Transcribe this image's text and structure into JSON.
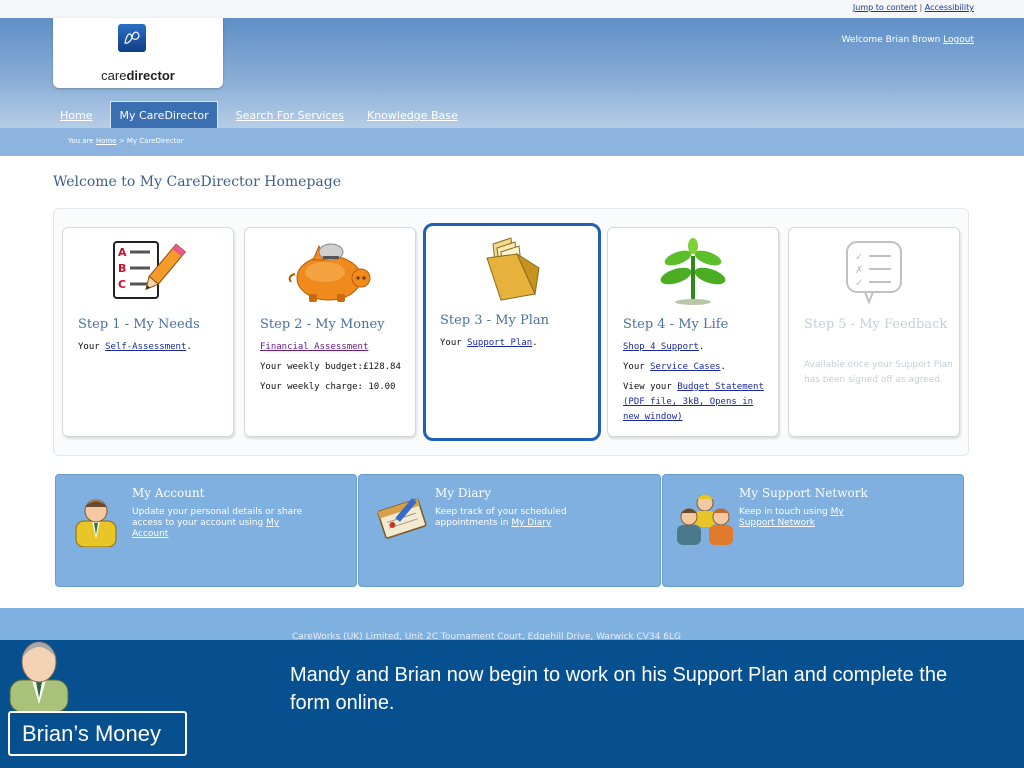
{
  "util": {
    "jump_link": "Jump to content",
    "separator": "|",
    "accessibility_link": "Accessibility"
  },
  "header": {
    "logo_text_light": "care",
    "logo_text_bold": "director",
    "welcome_text": "Welcome  Brian Brown",
    "logout_link": "Logout",
    "nav": [
      {
        "label": "Home",
        "active": false
      },
      {
        "label": "My CareDirector",
        "active": true
      },
      {
        "label": "Search For Services",
        "active": false
      },
      {
        "label": "Knowledge Base",
        "active": false
      }
    ]
  },
  "breadcrumb": {
    "prefix": "You are",
    "home": "Home",
    "current": "> My CareDirector"
  },
  "page_title": "Welcome to My CareDirector Homepage",
  "steps": [
    {
      "title": "Step 1 - My Needs",
      "icon": "checklist-pencil-icon",
      "line1_prefix": "Your ",
      "line1_link": "Self-Assessment",
      "line1_suffix": "."
    },
    {
      "title": "Step 2 - My Money",
      "icon": "piggy-bank-icon",
      "link": "Financial Assessment",
      "budget": "Your weekly budget:£128.84",
      "charge": "Your weekly charge: 10.00"
    },
    {
      "title": "Step 3 - My Plan",
      "icon": "folder-icon",
      "line1_prefix": "Your ",
      "line1_link": "Support Plan",
      "line1_suffix": "."
    },
    {
      "title": "Step 4 - My Life",
      "icon": "plant-icon",
      "link1": "Shop 4 Support",
      "link1_suffix": ".",
      "line2_prefix": "Your ",
      "link2": "Service Cases",
      "link2_suffix": ".",
      "line3_prefix": "View your ",
      "link3": "Budget Statement (PDF file, 3kB, Opens in new window)"
    },
    {
      "title": "Step 5 - My Feedback",
      "icon": "feedback-checklist-icon",
      "text": "Available once your Support Plan has been signed off as agreed."
    }
  ],
  "tiles": [
    {
      "title": "My Account",
      "icon": "person-icon",
      "text": "Update your personal details or share access to your account using ",
      "link": "My Account"
    },
    {
      "title": "My Diary",
      "icon": "diary-icon",
      "text": "Keep track of your scheduled appointments in ",
      "link": "My Diary"
    },
    {
      "title": "My Support Network",
      "icon": "group-icon",
      "text": "Keep in touch using ",
      "link": "My Support Network"
    }
  ],
  "footer": {
    "text": "CareWorks (UK) Limited, Unit 2C Tournament Court, Edgehill Drive, Warwick CV34 6LG"
  },
  "overlay": {
    "character_label": "Brian’s Money",
    "caption": "Mandy and Brian now begin to work on his Support Plan and complete the form online."
  }
}
